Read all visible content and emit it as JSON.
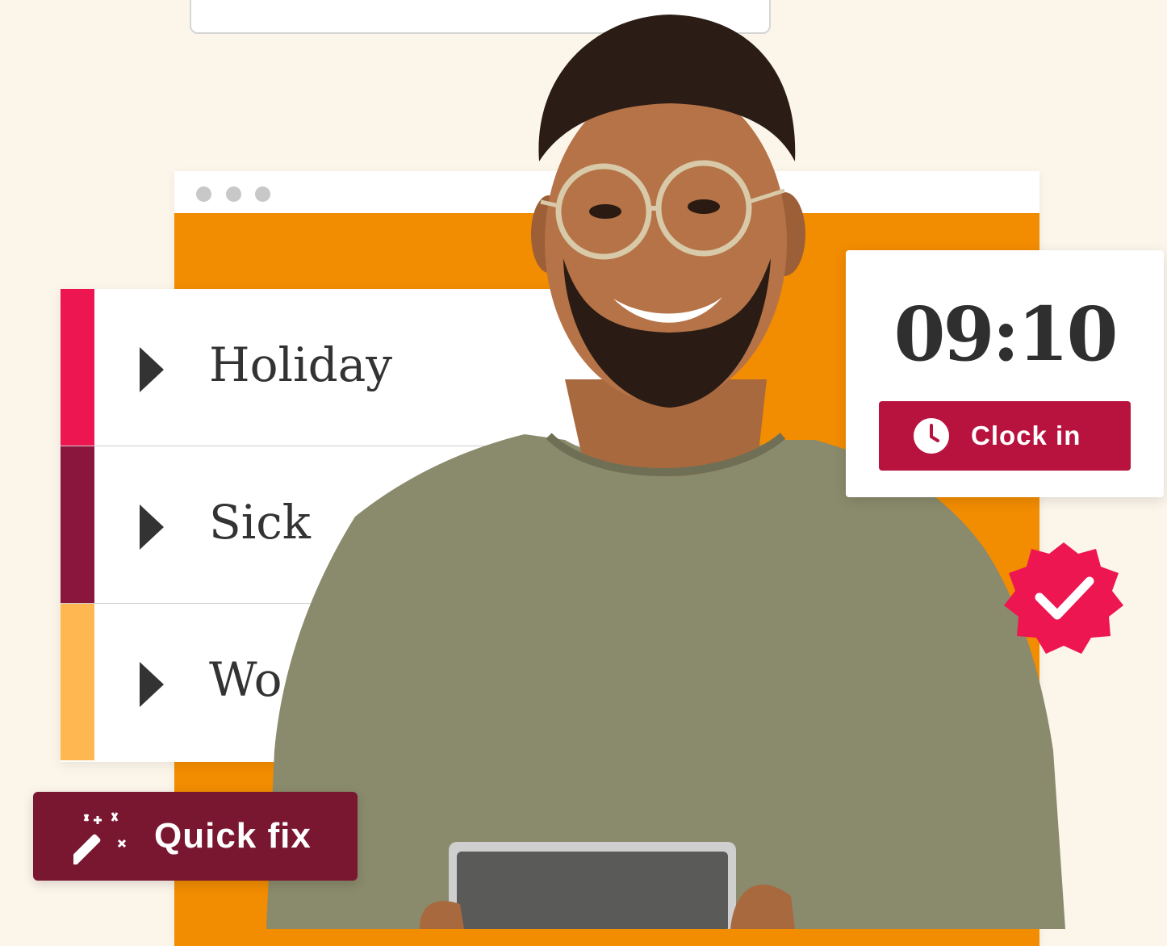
{
  "colors": {
    "page_background": "#fcf5ea",
    "orange_panel": "#f28c00",
    "accent_pink": "#ed1651",
    "accent_maroon": "#8a163d",
    "accent_yellow": "#ffb851",
    "clock_button": "#b8123f",
    "quick_fix_button": "#7a1730"
  },
  "categories": [
    {
      "label": "Holiday",
      "color": "#ed1651",
      "icon": "play-arrow-icon"
    },
    {
      "label": "Sick",
      "color": "#8a163d",
      "icon": "play-arrow-icon"
    },
    {
      "label": "Wo",
      "color": "#ffb851",
      "icon": "play-arrow-icon"
    }
  ],
  "clock": {
    "time": "09:10",
    "button_label": "Clock in",
    "button_icon": "clock-icon"
  },
  "badge": {
    "icon": "checkmark-badge-icon"
  },
  "quick_fix": {
    "label": "Quick fix",
    "icon": "magic-wand-icon"
  },
  "window": {
    "traffic_dots": 3
  }
}
